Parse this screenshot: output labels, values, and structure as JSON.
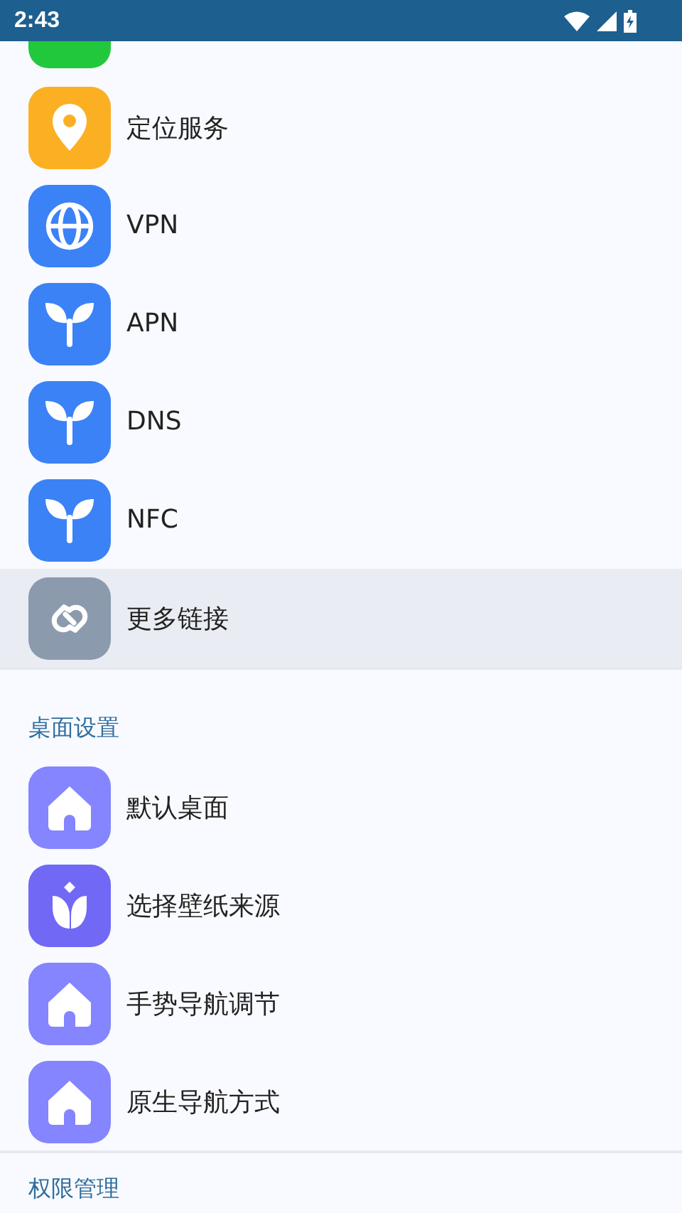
{
  "status_bar": {
    "time": "2:43"
  },
  "partial_item": {
    "color": "#22c83c"
  },
  "sections": [
    {
      "items": [
        {
          "label": "定位服务",
          "kind": "location",
          "color": "#fbb023",
          "selected": false
        },
        {
          "label": "VPN",
          "kind": "globe",
          "color": "#3b82f6",
          "selected": false
        },
        {
          "label": "APN",
          "kind": "sprout",
          "color": "#3b82f6",
          "selected": false
        },
        {
          "label": "DNS",
          "kind": "sprout",
          "color": "#3b82f6",
          "selected": false
        },
        {
          "label": "NFC",
          "kind": "sprout",
          "color": "#3b82f6",
          "selected": false
        },
        {
          "label": "更多链接",
          "kind": "link",
          "color": "#8c9aae",
          "selected": true
        }
      ]
    },
    {
      "header": "桌面设置",
      "items": [
        {
          "label": "默认桌面",
          "kind": "home",
          "color": "#8485ff",
          "selected": false
        },
        {
          "label": "选择壁纸来源",
          "kind": "tulip",
          "color": "#7168f5",
          "selected": false
        },
        {
          "label": "手势导航调节",
          "kind": "home",
          "color": "#8485ff",
          "selected": false
        },
        {
          "label": "原生导航方式",
          "kind": "home",
          "color": "#8485ff",
          "selected": false
        }
      ]
    },
    {
      "header": "权限管理"
    }
  ]
}
